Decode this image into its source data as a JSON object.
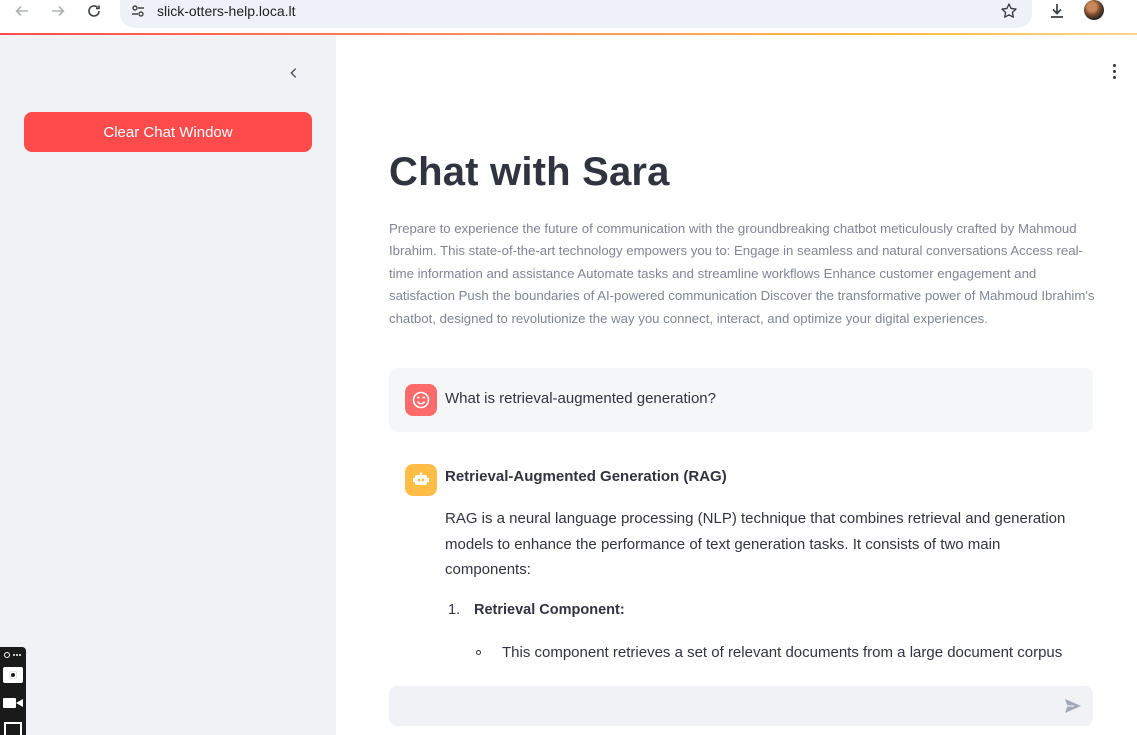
{
  "browser": {
    "url": "slick-otters-help.loca.lt"
  },
  "sidebar": {
    "clear_button_label": "Clear Chat Window"
  },
  "main": {
    "title": "Chat with Sara",
    "intro": "Prepare to experience the future of communication with the groundbreaking chatbot meticulously crafted by Mahmoud Ibrahim. This state-of-the-art technology empowers you to: Engage in seamless and natural conversations Access real-time information and assistance Automate tasks and streamline workflows Enhance customer engagement and satisfaction Push the boundaries of AI-powered communication Discover the transformative power of Mahmoud Ibrahim's chatbot, designed to revolutionize the way you connect, interact, and optimize your digital experiences.",
    "messages": {
      "user": {
        "text": "What is retrieval-augmented generation?"
      },
      "assistant": {
        "heading": "Retrieval-Augmented Generation (RAG)",
        "paragraph": "RAG is a neural language processing (NLP) technique that combines retrieval and generation models to enhance the performance of text generation tasks. It consists of two main components:",
        "list_number": "1.",
        "list_title": "Retrieval Component:",
        "sub_item": "This component retrieves a set of relevant documents from a large document corpus"
      }
    },
    "chat_input": {
      "value": "",
      "placeholder": ""
    }
  },
  "colors": {
    "accent": "#ff4b4b",
    "sidebar_bg": "#f0f2f6",
    "user_avatar": "#ff6b6b",
    "bot_avatar": "#ffbd45",
    "text": "#31333f"
  },
  "icons": {
    "back": "arrow-left-icon",
    "forward": "arrow-right-icon",
    "reload": "reload-icon",
    "site_info": "tune-icon",
    "bookmark": "star-icon",
    "download": "download-icon",
    "collapse": "chevron-left-icon",
    "menu": "more-vertical-icon",
    "send": "send-icon",
    "user": "smiley-face-icon",
    "assistant": "robot-icon"
  }
}
